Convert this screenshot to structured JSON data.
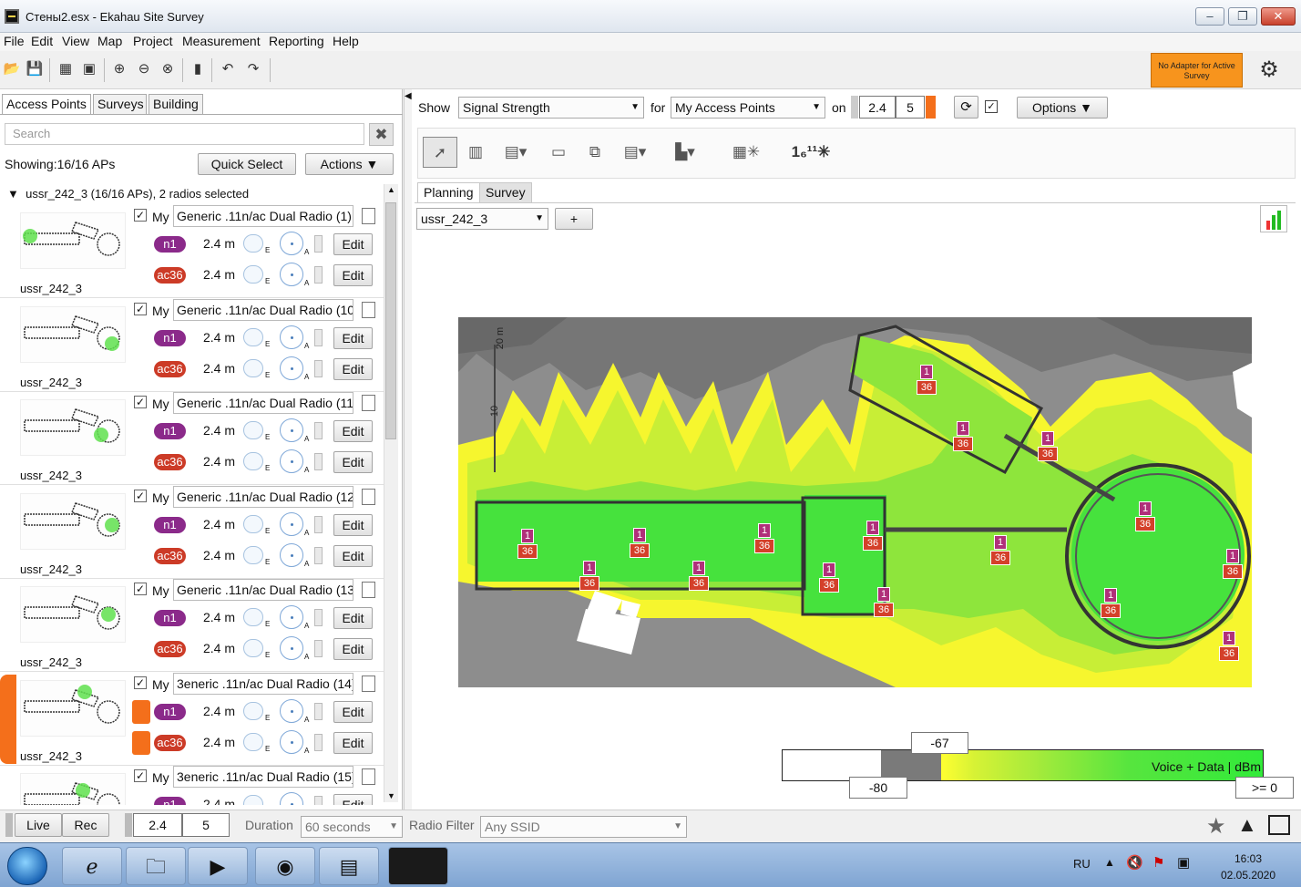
{
  "window": {
    "title": "Стены2.esx - Ekahau Site Survey",
    "minimize": "–",
    "maximize": "❐",
    "close": "✕"
  },
  "menu": [
    "File",
    "Edit",
    "View",
    "Map",
    "Project",
    "Measurement",
    "Reporting",
    "Help"
  ],
  "toolbar": {
    "no_adapter": "No Adapter for Active Survey"
  },
  "left": {
    "tabs": [
      "Access Points",
      "Surveys",
      "Building"
    ],
    "search_placeholder": "Search",
    "showing": "Showing:16/16 APs",
    "quick_select": "Quick Select",
    "actions": "Actions ▼",
    "group": "ussr_242_3 (16/16 APs), 2 radios selected",
    "aps": [
      {
        "name": "Generic .11n/ac Dual Radio (1)",
        "floor": "ussr_242_3",
        "my": "My",
        "selected": false
      },
      {
        "name": "Generic .11n/ac Dual Radio (10",
        "floor": "ussr_242_3",
        "my": "My",
        "selected": false
      },
      {
        "name": "Generic .11n/ac Dual Radio (11",
        "floor": "ussr_242_3",
        "my": "My",
        "selected": false
      },
      {
        "name": "Generic .11n/ac Dual Radio (12",
        "floor": "ussr_242_3",
        "my": "My",
        "selected": false
      },
      {
        "name": "Generic .11n/ac Dual Radio (13",
        "floor": "ussr_242_3",
        "my": "My",
        "selected": false
      },
      {
        "name": "3eneric .11n/ac Dual Radio (14)",
        "floor": "ussr_242_3",
        "my": "My",
        "selected": true
      },
      {
        "name": "3eneric .11n/ac Dual Radio (15)",
        "floor": "",
        "my": "My",
        "selected": false
      }
    ],
    "radio_n": "n1",
    "radio_ac": "ac36",
    "height": "2.4 m",
    "edit": "Edit",
    "ant_e": "E",
    "ant_a": "A"
  },
  "right": {
    "show_label": "Show",
    "show_value": "Signal Strength",
    "for_label": "for",
    "for_value": "My Access Points",
    "on_label": "on",
    "band_24": "2.4",
    "band_5": "5",
    "options": "Options ▼",
    "tabs": [
      "Planning",
      "Survey"
    ],
    "floor_select": "ussr_242_3",
    "add_floor": "+",
    "legend": {
      "label": "Voice + Data | dBm",
      "top": "-67",
      "min": "-80",
      "max": ">= 0"
    },
    "scale_marks": [
      "20 m",
      "10"
    ]
  },
  "bottom": {
    "live": "Live",
    "rec": "Rec",
    "band_24": "2.4",
    "band_5": "5",
    "duration_label": "Duration",
    "duration_value": "60 seconds",
    "radio_filter_label": "Radio Filter",
    "radio_filter_value": "Any SSID"
  },
  "taskbar": {
    "lang": "RU",
    "time": "16:03",
    "date": "02.05.2020"
  },
  "map_labels": {
    "channel_n": "1",
    "channel_ac": "36"
  },
  "colors": {
    "accent_orange": "#f46f1b",
    "n_badge": "#8b2a8a",
    "ac_badge": "#cc3b27",
    "coverage_strong": "#32ea3a",
    "coverage_weak": "#ffff31"
  }
}
